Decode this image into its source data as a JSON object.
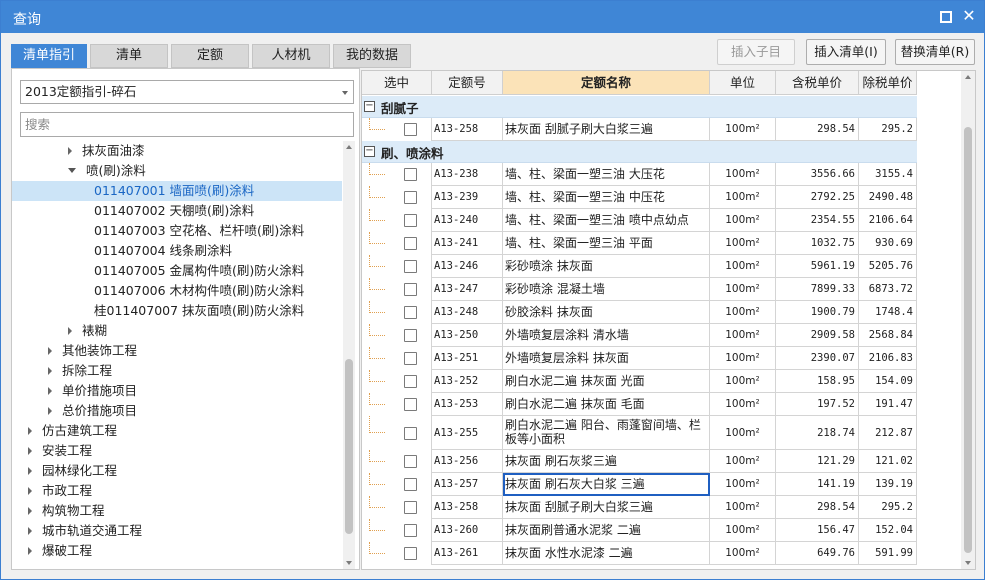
{
  "window": {
    "title": "查询"
  },
  "tabs": [
    {
      "label": "清单指引",
      "active": true
    },
    {
      "label": "清单",
      "active": false
    },
    {
      "label": "定额",
      "active": false
    },
    {
      "label": "人材机",
      "active": false
    },
    {
      "label": "我的数据",
      "active": false
    }
  ],
  "toolbar": {
    "insert_child": "插入子目",
    "insert_list": "插入清单(I)",
    "replace_list": "替换清单(R)"
  },
  "left": {
    "dropdown_value": "2013定额指引-碎石",
    "search_placeholder": "搜索",
    "tree": [
      {
        "label": "抹灰面油漆",
        "level": 2,
        "caret": "right"
      },
      {
        "label": "喷(刷)涂料",
        "level": 2,
        "caret": "down"
      },
      {
        "label": "011407001  墙面喷(刷)涂料",
        "level": 3,
        "selected": true
      },
      {
        "label": "011407002  天棚喷(刷)涂料",
        "level": 3
      },
      {
        "label": "011407003  空花格、栏杆喷(刷)涂料",
        "level": 3
      },
      {
        "label": "011407004  线条刷涂料",
        "level": 3
      },
      {
        "label": "011407005  金属构件喷(刷)防火涂料",
        "level": 3
      },
      {
        "label": "011407006  木材构件喷(刷)防火涂料",
        "level": 3
      },
      {
        "label": "桂011407007  抹灰面喷(刷)防火涂料",
        "level": 3
      },
      {
        "label": "裱糊",
        "level": 2,
        "caret": "right"
      },
      {
        "label": "其他装饰工程",
        "level": 1,
        "caret": "right"
      },
      {
        "label": "拆除工程",
        "level": 1,
        "caret": "right"
      },
      {
        "label": "单价措施项目",
        "level": 1,
        "caret": "right"
      },
      {
        "label": "总价措施项目",
        "level": 1,
        "caret": "right"
      },
      {
        "label": "仿古建筑工程",
        "level": 0,
        "caret": "right"
      },
      {
        "label": "安装工程",
        "level": 0,
        "caret": "right"
      },
      {
        "label": "园林绿化工程",
        "level": 0,
        "caret": "right"
      },
      {
        "label": "市政工程",
        "level": 0,
        "caret": "right"
      },
      {
        "label": "构筑物工程",
        "level": 0,
        "caret": "right"
      },
      {
        "label": "城市轨道交通工程",
        "level": 0,
        "caret": "right"
      },
      {
        "label": "爆破工程",
        "level": 0,
        "caret": "right"
      }
    ]
  },
  "grid": {
    "headers": [
      "选中",
      "定额号",
      "定额名称",
      "单位",
      "含税单价",
      "除税单价"
    ],
    "groups": [
      {
        "label": "刮腻子",
        "rows": [
          {
            "code": "A13-258",
            "name": "抹灰面 刮腻子刷大白浆三遍",
            "unit": "100m²",
            "tax": "298.54",
            "notax": "295.2"
          }
        ]
      },
      {
        "label": "刷、喷涂料",
        "rows": [
          {
            "code": "A13-238",
            "name": "墙、柱、梁面一塑三油 大压花",
            "unit": "100m²",
            "tax": "3556.66",
            "notax": "3155.4"
          },
          {
            "code": "A13-239",
            "name": "墙、柱、梁面一塑三油 中压花",
            "unit": "100m²",
            "tax": "2792.25",
            "notax": "2490.48"
          },
          {
            "code": "A13-240",
            "name": "墙、柱、梁面一塑三油 喷中点幼点",
            "unit": "100m²",
            "tax": "2354.55",
            "notax": "2106.64"
          },
          {
            "code": "A13-241",
            "name": "墙、柱、梁面一塑三油 平面",
            "unit": "100m²",
            "tax": "1032.75",
            "notax": "930.69"
          },
          {
            "code": "A13-246",
            "name": "彩砂喷涂 抹灰面",
            "unit": "100m²",
            "tax": "5961.19",
            "notax": "5205.76"
          },
          {
            "code": "A13-247",
            "name": "彩砂喷涂 混凝土墙",
            "unit": "100m²",
            "tax": "7899.33",
            "notax": "6873.72"
          },
          {
            "code": "A13-248",
            "name": "砂胶涂料 抹灰面",
            "unit": "100m²",
            "tax": "1900.79",
            "notax": "1748.4"
          },
          {
            "code": "A13-250",
            "name": "外墙喷复层涂料 清水墙",
            "unit": "100m²",
            "tax": "2909.58",
            "notax": "2568.84"
          },
          {
            "code": "A13-251",
            "name": "外墙喷复层涂料 抹灰面",
            "unit": "100m²",
            "tax": "2390.07",
            "notax": "2106.83"
          },
          {
            "code": "A13-252",
            "name": "刷白水泥二遍 抹灰面 光面",
            "unit": "100m²",
            "tax": "158.95",
            "notax": "154.09"
          },
          {
            "code": "A13-253",
            "name": "刷白水泥二遍 抹灰面 毛面",
            "unit": "100m²",
            "tax": "197.52",
            "notax": "191.47"
          },
          {
            "code": "A13-255",
            "name": "刷白水泥二遍 阳台、雨蓬窗间墙、栏板等小面积",
            "unit": "100m²",
            "tax": "218.74",
            "notax": "212.87",
            "tall": true
          },
          {
            "code": "A13-256",
            "name": "抹灰面 刷石灰浆三遍",
            "unit": "100m²",
            "tax": "121.29",
            "notax": "121.02"
          },
          {
            "code": "A13-257",
            "name": "抹灰面 刷石灰大白浆 三遍",
            "unit": "100m²",
            "tax": "141.19",
            "notax": "139.19",
            "focus": true
          },
          {
            "code": "A13-258",
            "name": "抹灰面 刮腻子刷大白浆三遍",
            "unit": "100m²",
            "tax": "298.54",
            "notax": "295.2"
          },
          {
            "code": "A13-260",
            "name": "抹灰面刷普通水泥浆 二遍",
            "unit": "100m²",
            "tax": "156.47",
            "notax": "152.04"
          },
          {
            "code": "A13-261",
            "name": "抹灰面 水性水泥漆 二遍",
            "unit": "100m²",
            "tax": "649.76",
            "notax": "591.99"
          }
        ]
      }
    ]
  }
}
